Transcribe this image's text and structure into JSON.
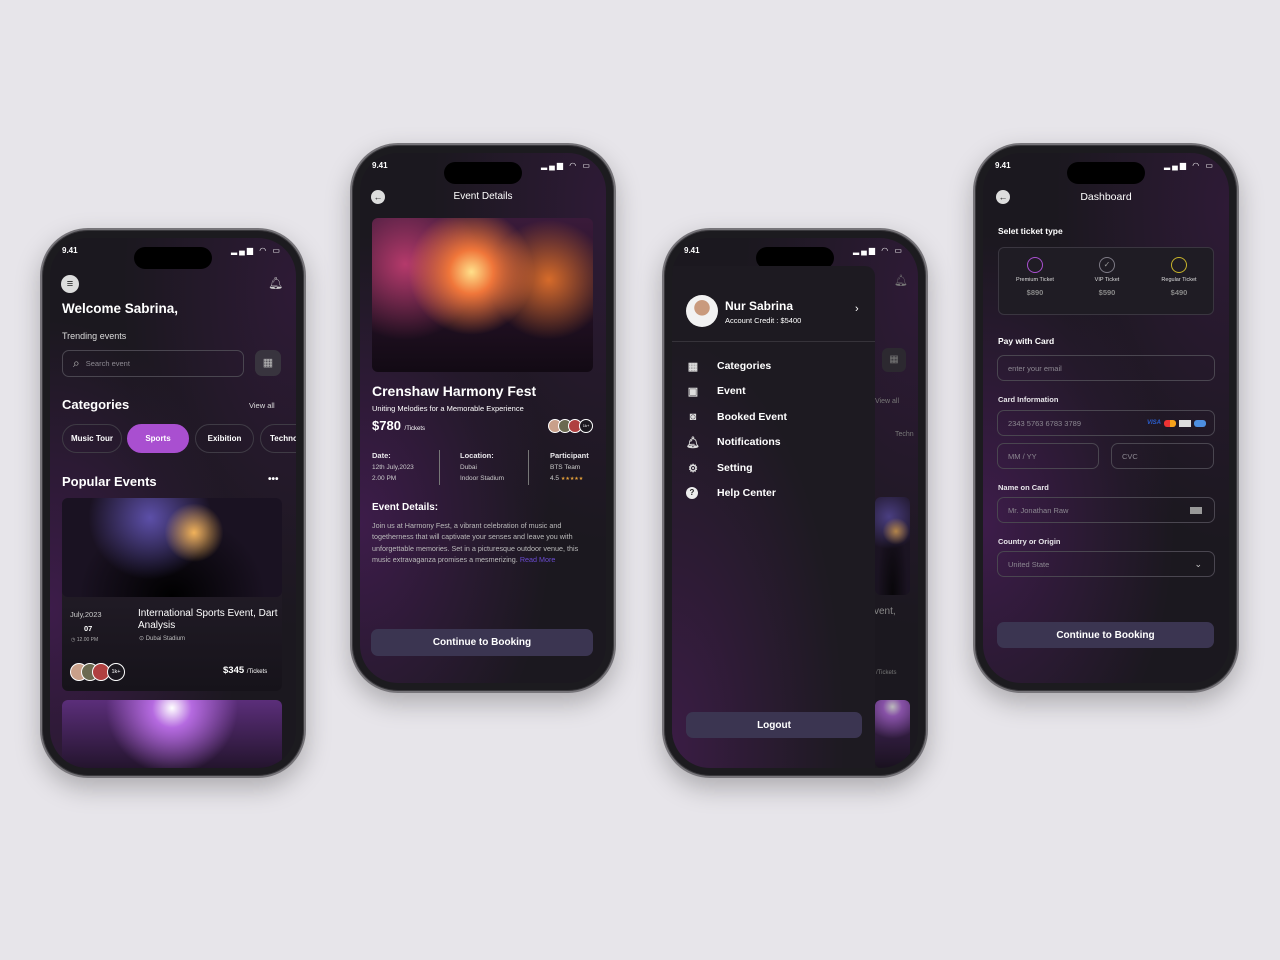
{
  "status": {
    "time": "9.41",
    "signal": "▮▮▮",
    "wifi": "wifi",
    "battery": "battery"
  },
  "home": {
    "greeting": "Welcome Sabrina,",
    "trending": "Trending events",
    "search_placeholder": "Search event",
    "categories_title": "Categories",
    "view_all": "View all",
    "categories": [
      "Music Tour",
      "Sports",
      "Exibition",
      "Techno"
    ],
    "active_category": "Sports",
    "popular_title": "Popular Events",
    "more": "•••",
    "event": {
      "month": "July,2023",
      "day": "07",
      "time": "12.00 PM",
      "title": "International Sports Event, Dart Analysis",
      "location": "Dubai Stadium",
      "attendees": "1k+",
      "price": "$345",
      "per": "/Tickets"
    }
  },
  "details": {
    "title": "Event Details",
    "event_title": "Crenshaw Harmony Fest",
    "subtitle": "Uniting Melodies for a Memorable Experience",
    "price": "$780",
    "per": "/Tickets",
    "attendees": "1k+",
    "date_label": "Date:",
    "date": "12th July,2023",
    "time": "2.00 PM",
    "location_label": "Location:",
    "location1": "Dubai",
    "location2": "Indoor Stadium",
    "participant_label": "Participant",
    "participant": "BTS Team",
    "rating": "4.5",
    "stars": "★★★★★",
    "section": "Event Details:",
    "description": "Join us at Harmony Fest, a vibrant celebration of music and togetherness that will captivate your senses and leave you with unforgettable memories. Set in a picturesque outdoor venue, this music extravaganza promises a mesmerizing.",
    "read_more": "Read More",
    "cta": "Continue to Booking"
  },
  "drawer": {
    "name": "Nur Sabrina",
    "credit": "Account Credit : $5400",
    "items": [
      {
        "label": "Categories",
        "icon": "grid-icon"
      },
      {
        "label": "Event",
        "icon": "calendar-icon"
      },
      {
        "label": "Booked Event",
        "icon": "ticket-icon"
      },
      {
        "label": "Notifications",
        "icon": "bell-icon"
      },
      {
        "label": "Setting",
        "icon": "gear-icon"
      },
      {
        "label": "Help Center",
        "icon": "help-icon"
      }
    ],
    "logout": "Logout",
    "bg_view_all": "View all",
    "bg_chip": "Techn",
    "bg_title": "vent,",
    "bg_per": "/Tickets"
  },
  "dashboard": {
    "title": "Dashboard",
    "ticket_section": "Selet ticket type",
    "tickets": [
      {
        "name": "Premium Ticket",
        "price": "$890",
        "color": "#a94fd0"
      },
      {
        "name": "VIP Ticket",
        "price": "$590",
        "color": "#7d7a85"
      },
      {
        "name": "Regular Ticket",
        "price": "$490",
        "color": "#c7b32a"
      }
    ],
    "pay_label": "Pay with Card",
    "email_placeholder": "enter your email",
    "card_label": "Card Information",
    "card_number": "2343 5763 6783 3789",
    "card_brands": "VISA",
    "expiry_placeholder": "MM / YY",
    "cvc_placeholder": "CVC",
    "name_label": "Name on Card",
    "name_value": "Mr. Jonathan Raw",
    "country_label": "Country or Origin",
    "country_value": "United State",
    "cta": "Continue to Booking"
  },
  "colors": {
    "accent": "#a94fd0",
    "button": "#3b3551",
    "background": "#1b181f",
    "link": "#6a4bd0"
  }
}
